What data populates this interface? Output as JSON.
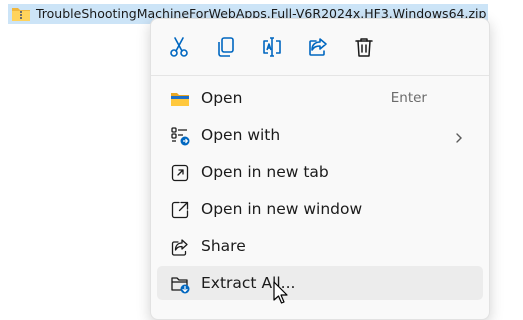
{
  "file": {
    "name": "TroubleShootingMachineForWebApps.Full-V6R2024x.HF3.Windows64.zip",
    "icon": "zip-folder-icon"
  },
  "context_menu": {
    "toolbar": [
      {
        "name": "cut",
        "icon": "scissors-icon"
      },
      {
        "name": "copy",
        "icon": "copy-icon"
      },
      {
        "name": "rename",
        "icon": "rename-icon"
      },
      {
        "name": "share",
        "icon": "share-icon"
      },
      {
        "name": "delete",
        "icon": "trash-icon"
      }
    ],
    "items": [
      {
        "label": "Open",
        "shortcut": "Enter",
        "icon": "folder-icon"
      },
      {
        "label": "Open with",
        "icon": "open-with-icon",
        "submenu": true
      },
      {
        "label": "Open in new tab",
        "icon": "new-tab-icon"
      },
      {
        "label": "Open in new window",
        "icon": "new-window-icon"
      },
      {
        "label": "Share",
        "icon": "share-icon"
      },
      {
        "label": "Extract All...",
        "icon": "extract-icon",
        "hovered": true
      }
    ]
  },
  "colors": {
    "selection": "#cce4f7",
    "menu_background": "#f9f9f9",
    "hover": "#ececec",
    "accent": "#0067c0",
    "folder": "#f0b73e"
  }
}
